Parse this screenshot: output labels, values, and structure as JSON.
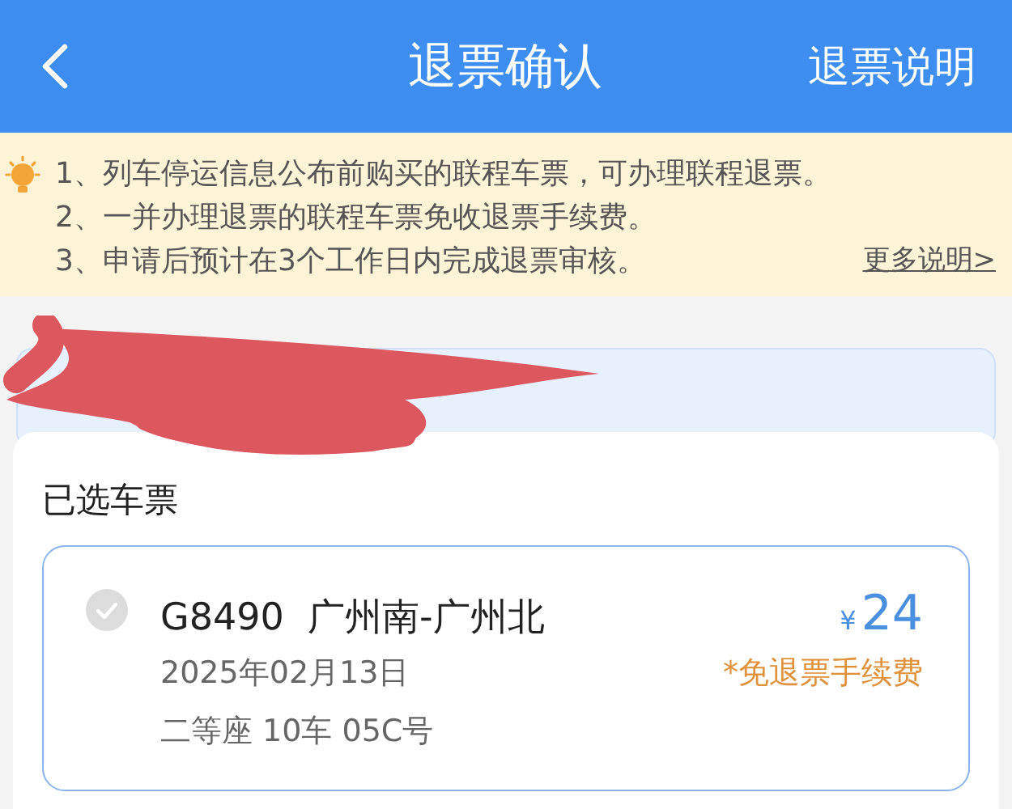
{
  "header": {
    "title": "退票确认",
    "action": "退票说明"
  },
  "notice": {
    "lines": [
      "1、列车停运信息公布前购买的联程车票，可办理联程退票。",
      "2、一并办理退票的联程车票免收退票手续费。",
      "3、申请后预计在3个工作日内完成退票审核。"
    ],
    "link": "更多说明>"
  },
  "section_title": "已选车票",
  "tickets": [
    {
      "checked": true,
      "disabled": true,
      "train": "G8490",
      "route": "广州南-广州北",
      "currency": "¥",
      "price": "24",
      "date": "2025年02月13日",
      "note": "*免退票手续费",
      "seat": "二等座 10车 05C号"
    }
  ]
}
